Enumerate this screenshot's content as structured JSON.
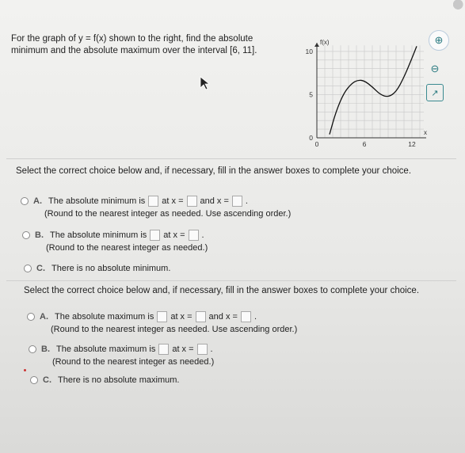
{
  "question": {
    "line1": "For the graph of y = f(x) shown to the right, find the absolute",
    "line2": "minimum and the absolute maximum over the interval [6, 11]."
  },
  "graph": {
    "y_axis_label": "f(x)",
    "x_axis_label": "x",
    "x_ticks": [
      {
        "value": 0,
        "label": "0"
      },
      {
        "value": 6,
        "label": "6"
      },
      {
        "value": 12,
        "label": "12"
      }
    ],
    "y_ticks": [
      {
        "value": 0,
        "label": "0"
      },
      {
        "value": 5,
        "label": "5"
      },
      {
        "value": 10,
        "label": "10"
      }
    ],
    "xlim": [
      0,
      14
    ],
    "ylim": [
      0,
      11
    ],
    "curve_color": "#111111",
    "grid_color": "#c8c8c8"
  },
  "tools": {
    "zoom_in": "⊕",
    "zoom_out": "⊖",
    "popout": "↗"
  },
  "part_min": {
    "prompt": "Select the correct choice below and, if necessary, fill in the answer boxes to complete your choice.",
    "a_letter": "A.",
    "a_text": "The absolute minimum is",
    "a_at": "at x =",
    "a_and": "and x =",
    "a_end": ".",
    "a_note": "(Round to the nearest integer as needed. Use ascending order.)",
    "b_letter": "B.",
    "b_text": "The absolute minimum is",
    "b_at": "at x =",
    "b_end": ".",
    "b_note": "(Round to the nearest integer as needed.)",
    "c_letter": "C.",
    "c_text": "There is no absolute minimum."
  },
  "part_max": {
    "prompt": "Select the correct choice below and, if necessary, fill in the answer boxes to complete your choice.",
    "a_letter": "A.",
    "a_text": "The absolute maximum is",
    "a_at": "at x =",
    "a_and": "and x =",
    "a_end": ".",
    "a_note": "(Round to the nearest integer as needed. Use ascending order.)",
    "b_letter": "B.",
    "b_text": "The absolute maximum is",
    "b_at": "at x =",
    "b_end": ".",
    "b_note": "(Round to the nearest integer as needed.)",
    "c_letter": "C.",
    "c_text": "There is no absolute maximum."
  }
}
